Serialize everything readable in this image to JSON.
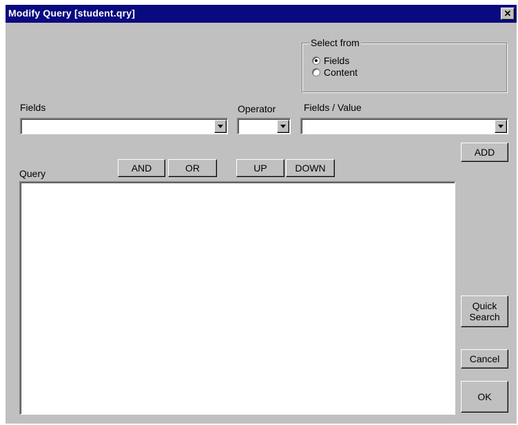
{
  "window": {
    "title": "Modify Query [student.qry]",
    "close_glyph": "✕"
  },
  "select_from": {
    "legend": "Select from",
    "options": [
      {
        "label": "Fields",
        "selected": true
      },
      {
        "label": "Content",
        "selected": false
      }
    ]
  },
  "fields": {
    "label": "Fields",
    "value": ""
  },
  "operator": {
    "label": "Operator",
    "value": ""
  },
  "fields_value": {
    "label": "Fields / Value",
    "value": ""
  },
  "buttons": {
    "add": "ADD",
    "and": "AND",
    "or": "OR",
    "up": "UP",
    "down": "DOWN",
    "quick_search_line1": "Quick",
    "quick_search_line2": "Search",
    "cancel": "Cancel",
    "ok": "OK"
  },
  "query": {
    "label": "Query",
    "value": ""
  },
  "colors": {
    "titlebar": "#0a0a80",
    "face": "#c0c0c0"
  }
}
